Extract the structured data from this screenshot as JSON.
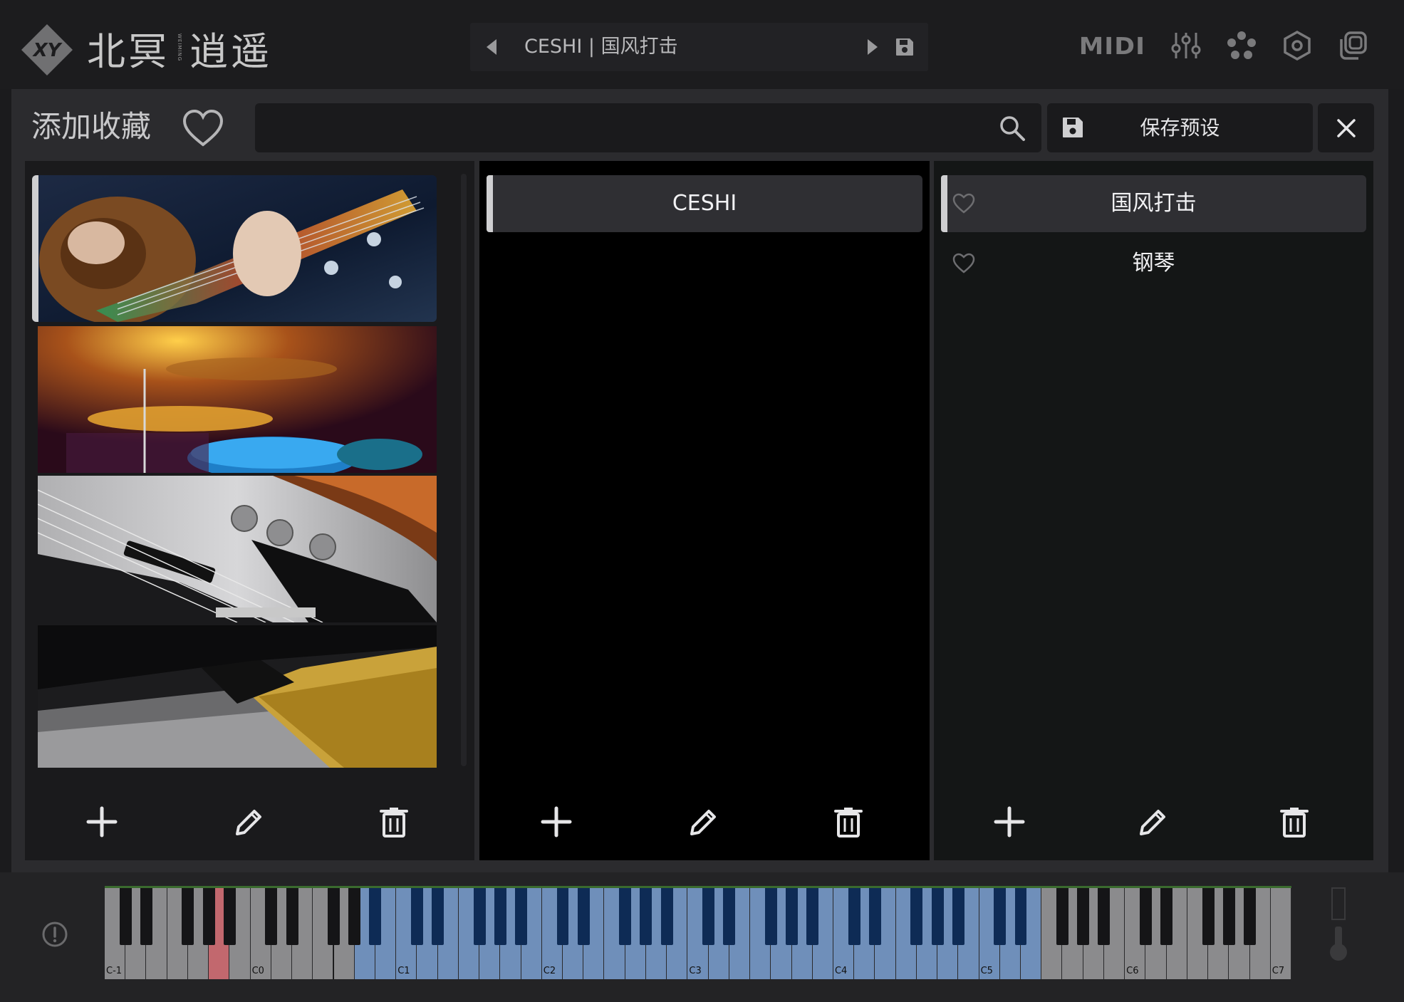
{
  "app": {
    "logo_text": "北冥",
    "logo_text_2": "逍遥",
    "logo_badge": "XY",
    "logo_sub": "WEIMING"
  },
  "header": {
    "preset_name": "CESHI | 国风打击",
    "icons": [
      "prev-preset-icon",
      "next-preset-icon",
      "save-icon",
      "midi-icon",
      "mixer-icon",
      "flower-icon",
      "settings-icon",
      "layers-icon"
    ],
    "midi_label": "MIDI"
  },
  "toolbar": {
    "title": "添加收藏",
    "search_placeholder": "",
    "save_preset_label": "保存预设"
  },
  "columns": {
    "categories": [
      {
        "name": "guitar",
        "selected": true
      },
      {
        "name": "drums",
        "selected": false
      },
      {
        "name": "bass",
        "selected": false
      },
      {
        "name": "piano",
        "selected": false
      }
    ],
    "banks": [
      {
        "label": "CESHI",
        "selected": true
      }
    ],
    "presets": [
      {
        "label": "国风打击",
        "selected": true
      },
      {
        "label": "钢琴",
        "selected": false
      }
    ]
  },
  "keyboard": {
    "octave_labels": [
      "C-1",
      "C0",
      "C1",
      "C2",
      "C3",
      "C4",
      "C5",
      "C6",
      "C7"
    ],
    "colors": {
      "white_inactive": "#8b8b8d",
      "white_active": "#6f8fba",
      "black_active": "#0e2b55",
      "pressed": "#c2686e"
    }
  },
  "colors": {
    "background": "#1b1b1d",
    "panel": "#2b2b2e",
    "accent": "#cfcfd1",
    "text": "#f2f2f4"
  }
}
